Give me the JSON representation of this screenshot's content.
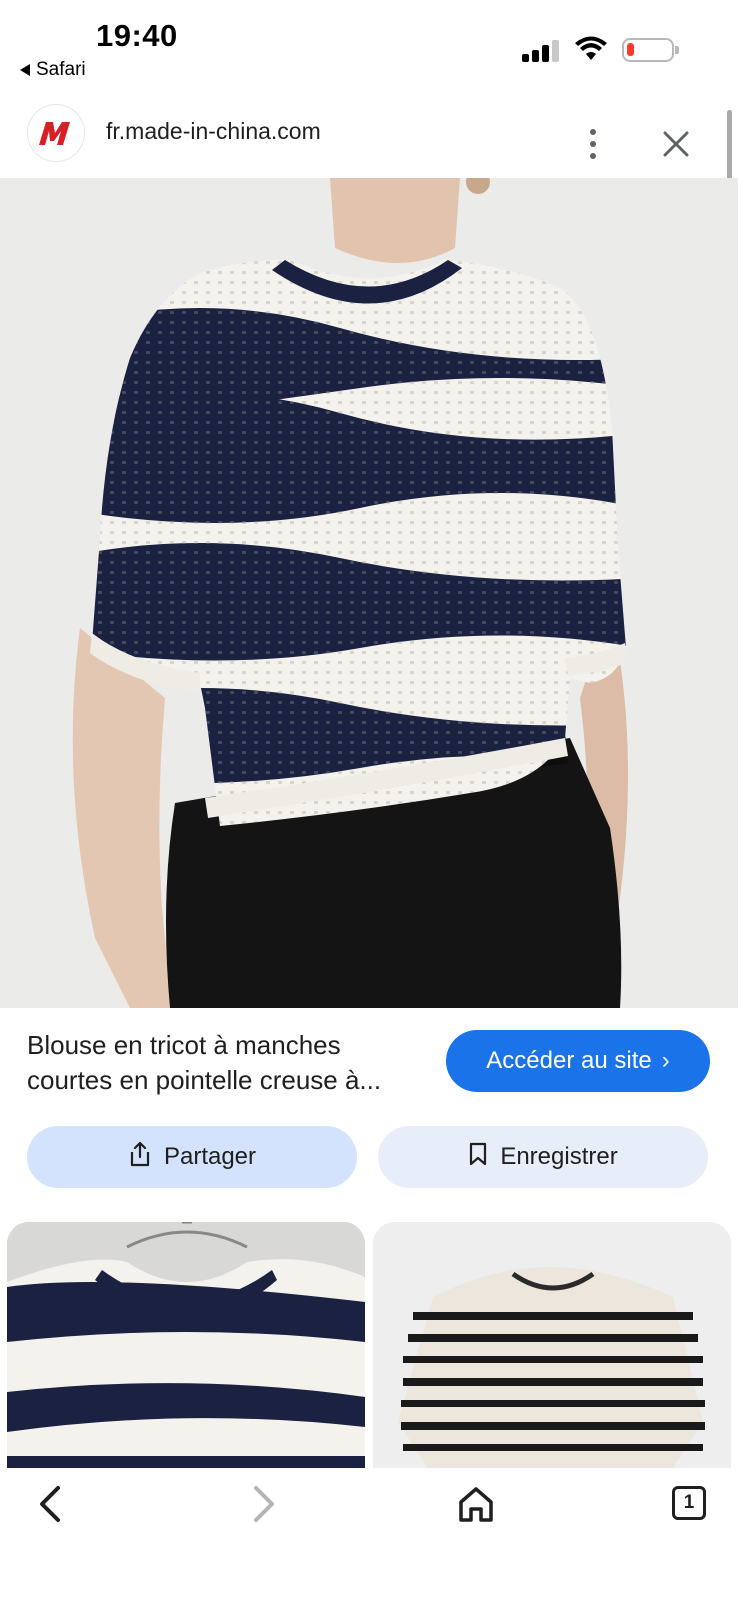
{
  "status_bar": {
    "time": "19:40",
    "back_app": "Safari"
  },
  "header": {
    "url": "fr.made-in-china.com",
    "logo_icon": "made-in-china-logo-icon",
    "more_icon": "more-vert-icon",
    "close_icon": "close-icon"
  },
  "hero": {
    "image": "striped-knit-blouse-photo"
  },
  "result": {
    "title": "Blouse en tricot à manches courtes en pointelle creuse à...",
    "visit_label": "Accéder au site",
    "share_label": "Partager",
    "save_label": "Enregistrer"
  },
  "related": [
    {
      "image": "navy-white-wavy-knit-top-photo"
    },
    {
      "image": "black-white-striped-knit-top-photo"
    }
  ],
  "bottom_nav": {
    "tab_count": "1"
  },
  "colors": {
    "accent": "#1a73e8",
    "share_bg": "#d3e3fd",
    "save_bg": "#e8eef9",
    "navy": "#1b2140",
    "cream": "#f4f2ec"
  }
}
